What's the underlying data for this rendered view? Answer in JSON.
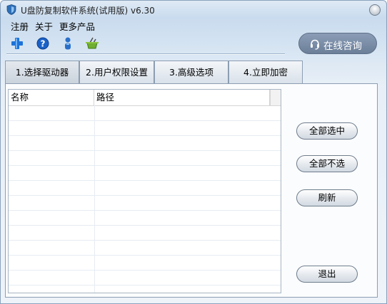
{
  "window": {
    "title": "U盘防复制软件系统(试用版) v6.30"
  },
  "menu": {
    "items": [
      "注册",
      "关于",
      "更多产品"
    ]
  },
  "toolbar": {
    "icons": [
      "add-icon",
      "help-icon",
      "user-icon",
      "basket-icon"
    ]
  },
  "consult_button": {
    "label": "在线咨询",
    "icon": "headset-icon"
  },
  "tabs": [
    "1.选择驱动器",
    "2.用户权限设置",
    "3.高级选项",
    "4.立即加密"
  ],
  "active_tab": 0,
  "drive_list": {
    "columns": [
      "名称",
      "路径"
    ],
    "rows": []
  },
  "side_buttons": {
    "select_all": "全部选中",
    "select_none": "全部不选",
    "refresh": "刷新",
    "exit": "退出"
  },
  "colors": {
    "consult_button": "#7a8ca6",
    "window_bg": "#dce8f4",
    "add_icon": "#1e73d8",
    "help_icon": "#1a62c8"
  }
}
